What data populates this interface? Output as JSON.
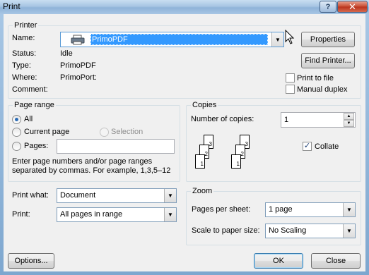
{
  "window": {
    "title": "Print",
    "help_glyph": "?",
    "close_glyph": "✕"
  },
  "printer": {
    "group_label": "Printer",
    "name_label": "Name:",
    "name_value": "PrimoPDF",
    "status_label": "Status:",
    "status_value": "Idle",
    "type_label": "Type:",
    "type_value": "PrimoPDF",
    "where_label": "Where:",
    "where_value": "PrimoPort:",
    "comment_label": "Comment:",
    "comment_value": "",
    "properties_button": "Properties",
    "find_printer_button": "Find Printer...",
    "print_to_file_label": "Print to file",
    "print_to_file_checked": false,
    "manual_duplex_label": "Manual duplex",
    "manual_duplex_checked": false
  },
  "page_range": {
    "group_label": "Page range",
    "all_label": "All",
    "current_page_label": "Current page",
    "selection_label": "Selection",
    "pages_label": "Pages:",
    "pages_value": "",
    "selected": "All",
    "hint_line1": "Enter page numbers and/or page ranges",
    "hint_line2": "separated by commas.  For example, 1,3,5–12"
  },
  "copies": {
    "group_label": "Copies",
    "number_label": "Number of copies:",
    "number_value": "1",
    "collate_label": "Collate",
    "collate_checked": true,
    "stack_pages": [
      "3",
      "2",
      "1"
    ]
  },
  "print_what": {
    "label": "Print what:",
    "value": "Document"
  },
  "print": {
    "label": "Print:",
    "value": "All pages in range"
  },
  "zoom": {
    "group_label": "Zoom",
    "pages_per_sheet_label": "Pages per sheet:",
    "pages_per_sheet_value": "1 page",
    "scale_label": "Scale to paper size:",
    "scale_value": "No Scaling"
  },
  "buttons": {
    "options": "Options...",
    "ok": "OK",
    "close": "Close"
  }
}
